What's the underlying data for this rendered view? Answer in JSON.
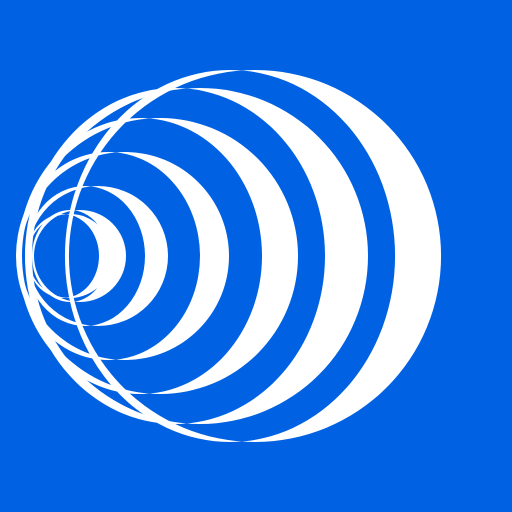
{
  "icon": {
    "name": "signal-waves-icon",
    "background_color": "#0062E3",
    "foreground_color": "#FFFFFF",
    "arc_count": 7
  }
}
